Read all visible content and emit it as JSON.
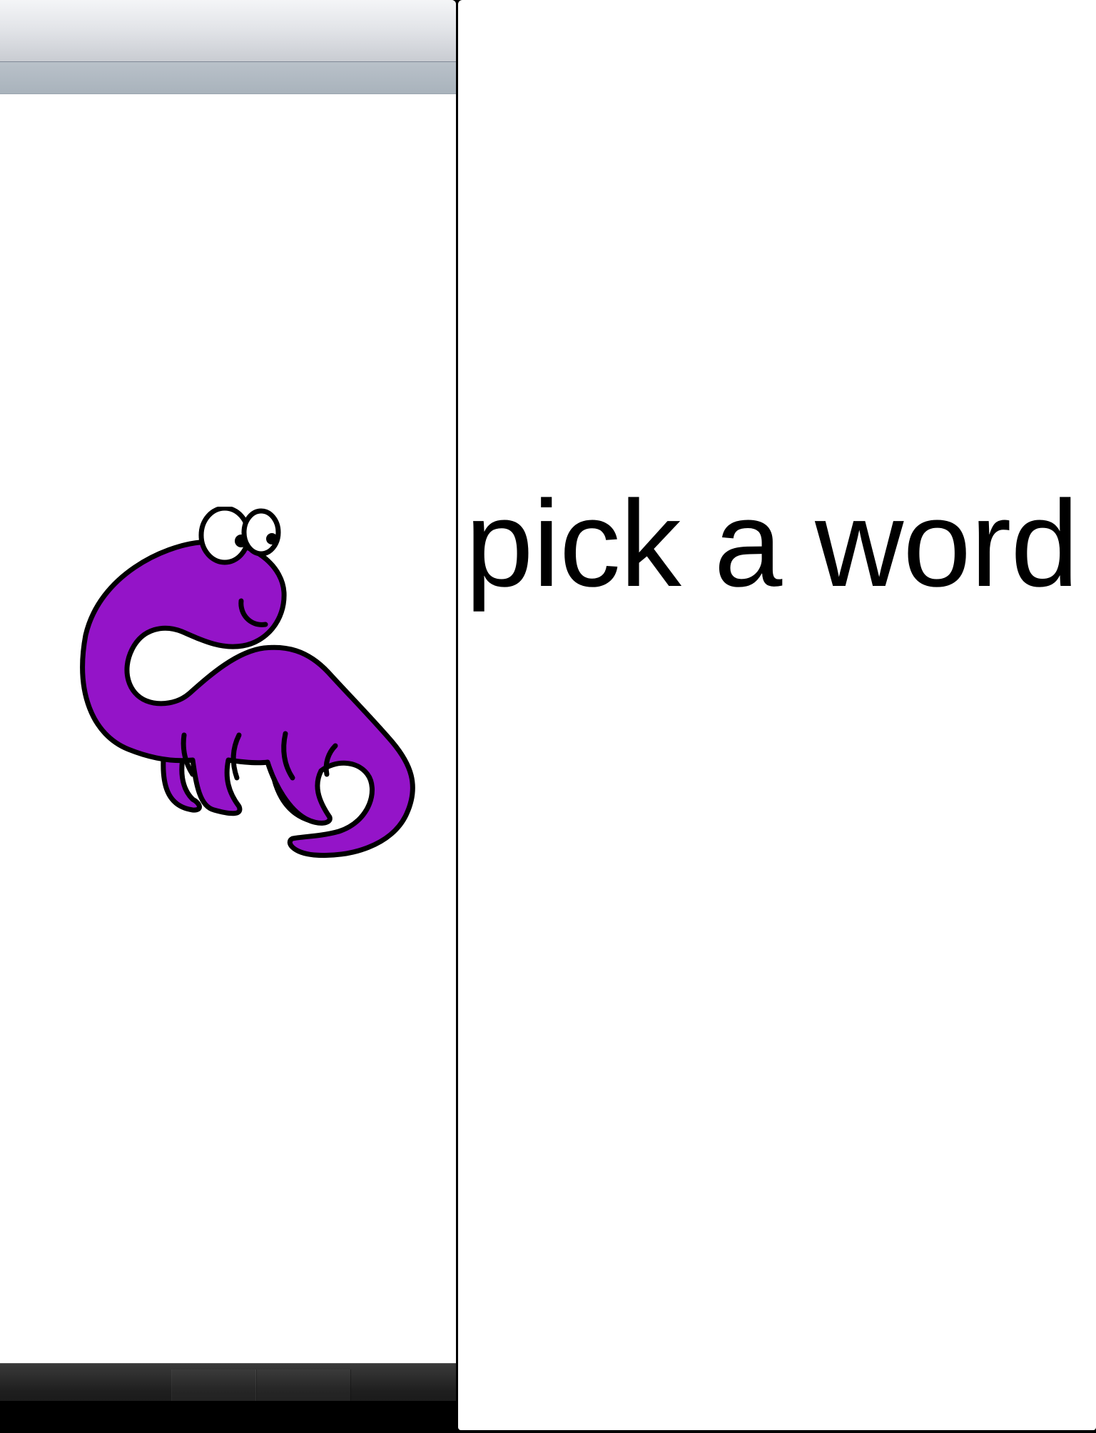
{
  "detail": {
    "prompt_text": "pick a word"
  },
  "master": {
    "illustration": {
      "icon": "purple-dinosaur-illustration",
      "body_color": "#9414c8",
      "outline_color": "#000000"
    }
  },
  "colors": {
    "background": "#ffffff",
    "screen_background": "#000000",
    "nav_bar": "#e3e5e9",
    "sub_bar": "#aeb7c0",
    "toolbar": "#1e1e1e"
  }
}
